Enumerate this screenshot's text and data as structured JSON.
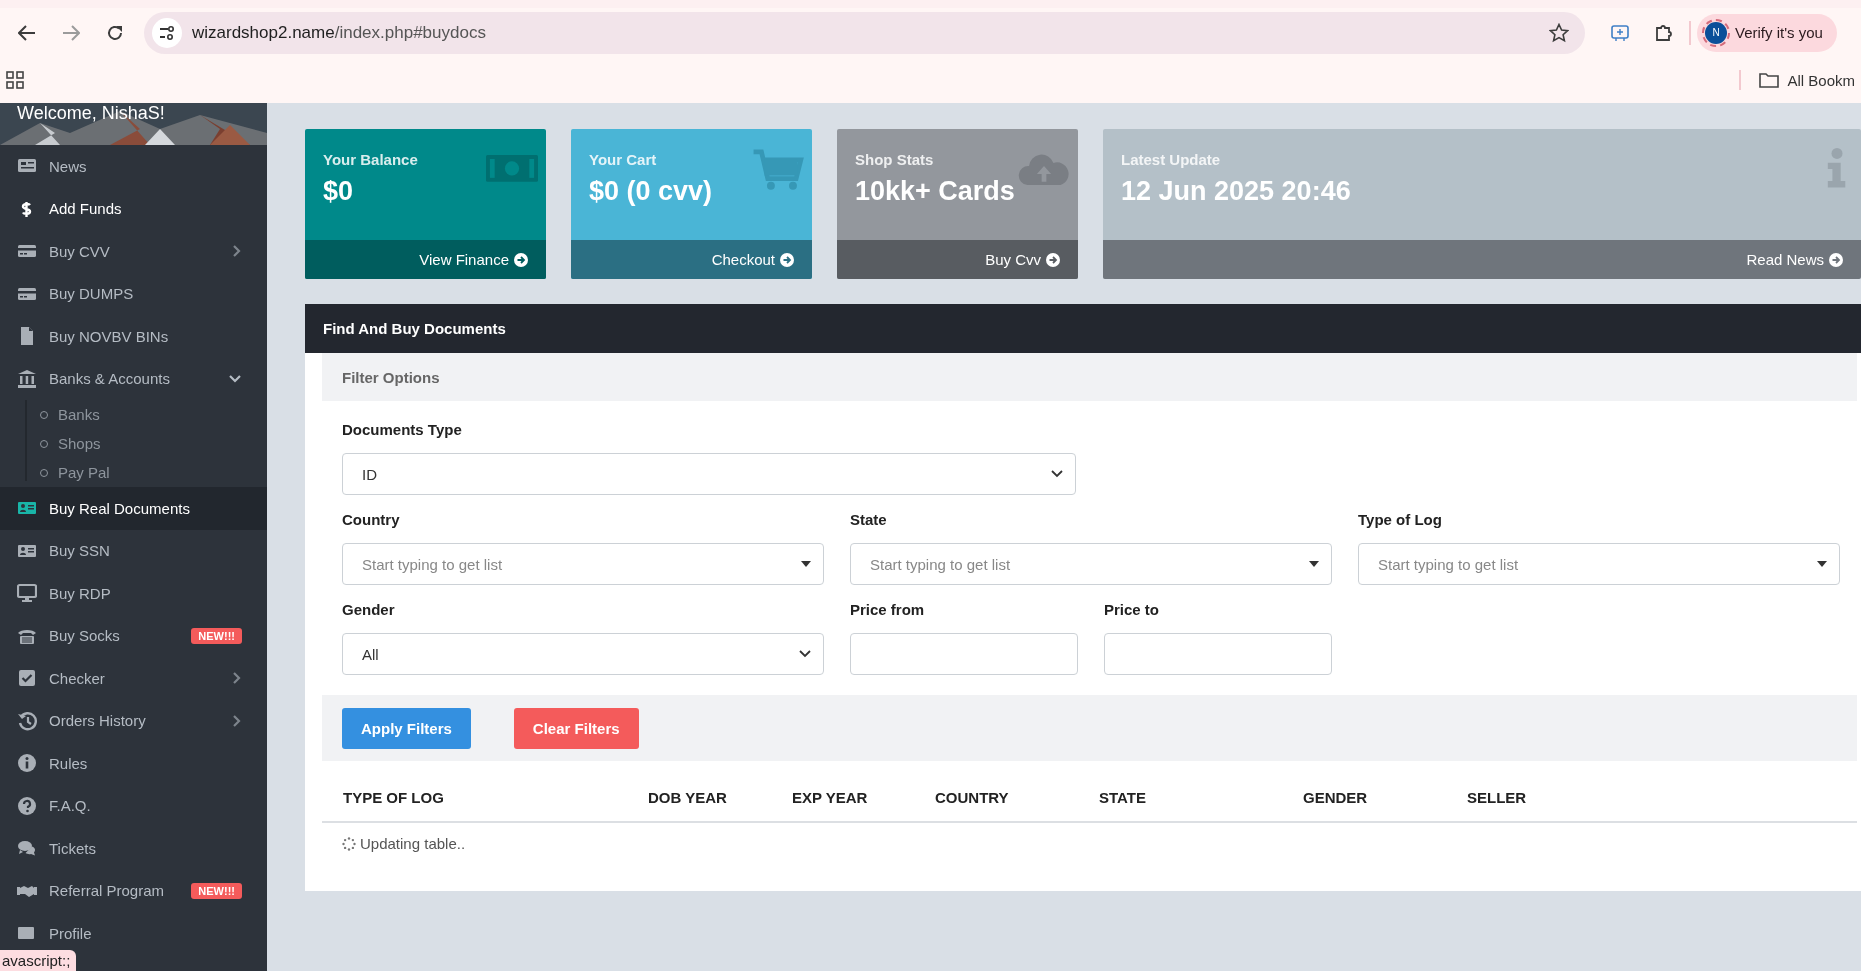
{
  "browser": {
    "url_host": "wizardshop2.name",
    "url_path": "/index.php#buydocs",
    "profile_button": "Verify it's you",
    "avatar_letter": "N",
    "bookmarks_label": "All Bookm"
  },
  "sidebar": {
    "welcome": "Welcome, NishaS!",
    "items": [
      {
        "label": "News",
        "selected": false
      },
      {
        "label": "Add Funds",
        "selected": false
      },
      {
        "label": "Buy CVV",
        "selected": false,
        "expanded": false
      },
      {
        "label": "Buy DUMPS",
        "selected": false
      },
      {
        "label": "Buy NOVBV BINs",
        "selected": false
      },
      {
        "label": "Banks & Accounts",
        "selected": false,
        "expanded": true,
        "children": [
          {
            "label": "Banks",
            "selected": false
          },
          {
            "label": "Shops",
            "selected": false
          },
          {
            "label": "Pay Pal",
            "selected": false
          }
        ]
      },
      {
        "label": "Buy Real Documents",
        "selected": true
      },
      {
        "label": "Buy SSN",
        "selected": false
      },
      {
        "label": "Buy RDP",
        "selected": false
      },
      {
        "label": "Buy Socks",
        "selected": false,
        "badge": "NEW!!!"
      },
      {
        "label": "Checker",
        "selected": false,
        "expanded": false
      },
      {
        "label": "Orders History",
        "selected": false,
        "expanded": false
      },
      {
        "label": "Rules",
        "selected": false
      },
      {
        "label": "F.A.Q.",
        "selected": false
      },
      {
        "label": "Tickets",
        "selected": false
      },
      {
        "label": "Referral Program",
        "selected": false,
        "badge": "NEW!!!"
      },
      {
        "label": "Profile",
        "selected": false
      }
    ]
  },
  "stat_cards": [
    {
      "title": "Your Balance",
      "value": "$0",
      "link": "View Finance"
    },
    {
      "title": "Your Cart",
      "value": "$0 (0 cvv)",
      "link": "Checkout"
    },
    {
      "title": "Shop Stats",
      "value": "10kk+ Cards",
      "link": "Buy Cvv"
    },
    {
      "title": "Latest Update",
      "value": "12 Jun 2025 20:46",
      "link": "Read News"
    }
  ],
  "panel": {
    "title": "Find And Buy Documents",
    "filter_title": "Filter Options",
    "documents_type": {
      "label": "Documents Type",
      "value": "ID"
    },
    "country": {
      "label": "Country",
      "placeholder": "Start typing to get list"
    },
    "state": {
      "label": "State",
      "placeholder": "Start typing to get list"
    },
    "type_of_log": {
      "label": "Type of Log",
      "placeholder": "Start typing to get list"
    },
    "gender": {
      "label": "Gender",
      "value": "All"
    },
    "price_from": {
      "label": "Price from"
    },
    "price_to": {
      "label": "Price to"
    },
    "buttons": [
      "Apply Filters",
      "Clear Filters"
    ],
    "table": {
      "columns": [
        "TYPE OF LOG",
        "DOB YEAR",
        "EXP YEAR",
        "COUNTRY",
        "STATE",
        "GENDER",
        "SELLER"
      ],
      "status": "Updating table.."
    }
  },
  "status_tooltip": "avascript:;"
}
